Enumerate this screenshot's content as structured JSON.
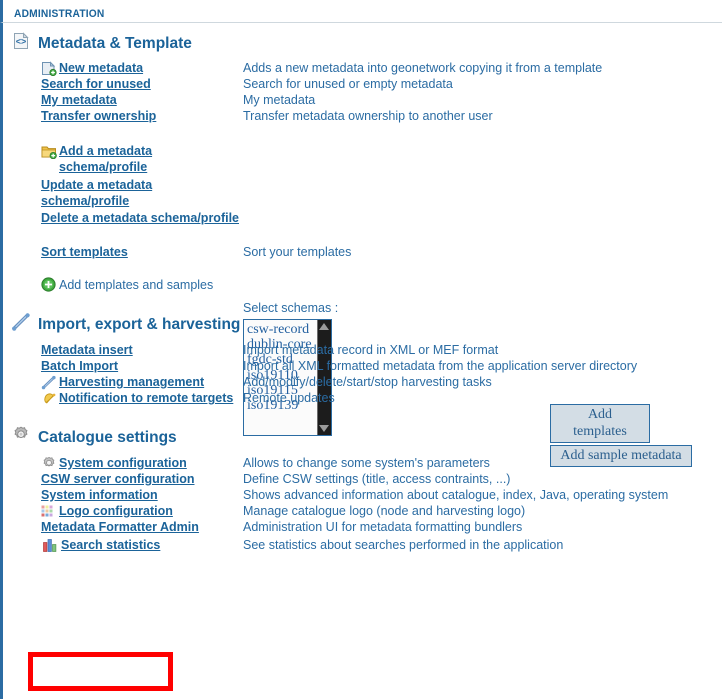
{
  "header": {
    "title": "ADMINISTRATION"
  },
  "sections": [
    {
      "id": "metadata-template",
      "title": "Metadata & Template",
      "icon": "code-document-icon",
      "rows": [
        {
          "label": "New metadata",
          "desc": "Adds a new metadata into geonetwork copying it from a template",
          "icon": "new-document-icon",
          "link": true
        },
        {
          "label": "Search for unused",
          "desc": "Search for unused or empty metadata",
          "icon": "",
          "link": true
        },
        {
          "label": "My metadata",
          "desc": "My metadata",
          "icon": "",
          "link": true
        },
        {
          "label": "Transfer ownership",
          "desc": "Transfer metadata ownership to another user",
          "icon": "",
          "link": true
        },
        {
          "label": "",
          "desc": "",
          "icon": "",
          "link": false
        },
        {
          "label": "Add a metadata schema/profile",
          "desc": "",
          "icon": "folder-add-icon",
          "link": true
        },
        {
          "label": "Update a metadata schema/profile",
          "desc": "",
          "icon": "",
          "link": true
        },
        {
          "label": "Delete a metadata schema/profile",
          "desc": "",
          "icon": "",
          "link": true
        },
        {
          "label": "",
          "desc": "",
          "icon": "",
          "link": false
        },
        {
          "label": "Sort templates",
          "desc": "Sort your templates",
          "icon": "",
          "link": true
        },
        {
          "label": "",
          "desc": "",
          "icon": "",
          "link": false
        },
        {
          "label": "Add templates and samples",
          "desc": "",
          "icon": "green-plus-icon",
          "link": false
        }
      ]
    },
    {
      "id": "import-export-harvesting",
      "title": "Import, export & harvesting",
      "icon": "wand-icon",
      "rows": [
        {
          "label": "Metadata insert",
          "desc": "Import metadata record in XML or MEF format",
          "icon": "",
          "link": true
        },
        {
          "label": "Batch Import",
          "desc": "Import all XML formatted metadata from the application server directory",
          "icon": "",
          "link": true
        },
        {
          "label": "Harvesting management",
          "desc": "Add/modify/delete/start/stop harvesting tasks",
          "icon": "wand-small-icon",
          "link": true
        },
        {
          "label": "Notification to remote targets",
          "desc": "Remote updates",
          "icon": "bell-icon",
          "link": true
        }
      ]
    },
    {
      "id": "catalogue-settings",
      "title": "Catalogue settings",
      "icon": "gear-icon",
      "rows": [
        {
          "label": "System configuration",
          "desc": "Allows to change some system's parameters",
          "icon": "gear-small-icon",
          "link": true
        },
        {
          "label": "CSW server configuration",
          "desc": "Define CSW settings (title, access contraints, ...)",
          "icon": "",
          "link": true
        },
        {
          "label": "System information",
          "desc": "Shows advanced information about catalogue, index, Java, operating system",
          "icon": "",
          "link": true
        },
        {
          "label": "Logo configuration",
          "desc": "Manage catalogue logo (node and harvesting logo)",
          "icon": "pixel-grid-icon",
          "link": true
        },
        {
          "label": "Metadata Formatter Admin",
          "desc": "Administration UI for metadata formatting bundlers",
          "icon": "",
          "link": true
        },
        {
          "label": "Search statistics",
          "desc": "See statistics about searches performed in the application",
          "icon": "bar-chart-icon",
          "link": true
        }
      ]
    }
  ],
  "schemas": {
    "label": "Select schemas :",
    "options": [
      "csw-record",
      "dublin-core",
      "fgdc-std",
      "iso19110",
      "iso19115",
      "iso19139"
    ]
  },
  "buttons": {
    "add_templates": "Add templates",
    "add_sample_metadata": "Add sample metadata"
  },
  "annotation": {
    "color": "#ff0000",
    "target": "Search statistics"
  },
  "colors": {
    "link": "#1b6399",
    "text": "#2b6ca3",
    "accent_border": "#2b6ca3",
    "highlight": "#ff0000"
  }
}
